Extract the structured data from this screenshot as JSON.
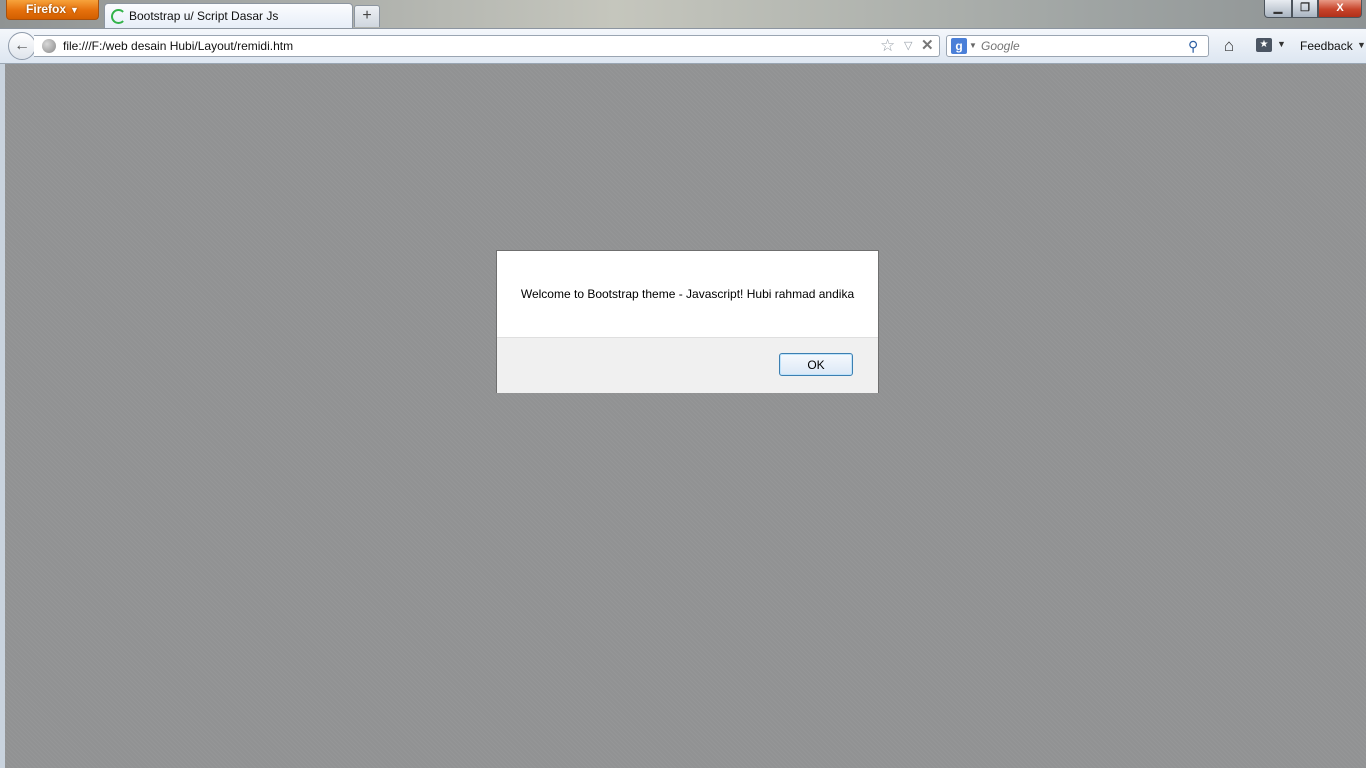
{
  "browser": {
    "app_button_label": "Firefox",
    "tab": {
      "title": "Bootstrap u/ Script Dasar Js"
    },
    "new_tab_label": "+",
    "url": "file:///F:/web desain Hubi/Layout/remidi.htm",
    "search": {
      "engine": "Google",
      "placeholder": "Google"
    },
    "feedback_label": "Feedback",
    "window_controls": {
      "close_label": "X"
    }
  },
  "alert": {
    "message": "Welcome to Bootstrap theme - Javascript! Hubi rahmad andika",
    "ok_label": "OK"
  },
  "colors": {
    "overlay": "#919293",
    "firefox_button": "#e5700c",
    "alert_footer": "#f0f0f0",
    "ok_border": "#3c7fb1"
  },
  "icons": [
    "spinner-icon",
    "back-arrow-icon",
    "globe-icon",
    "star-icon",
    "stop-icon",
    "google-icon",
    "search-icon",
    "home-icon",
    "bookmarks-icon",
    "chevron-down-icon"
  ]
}
